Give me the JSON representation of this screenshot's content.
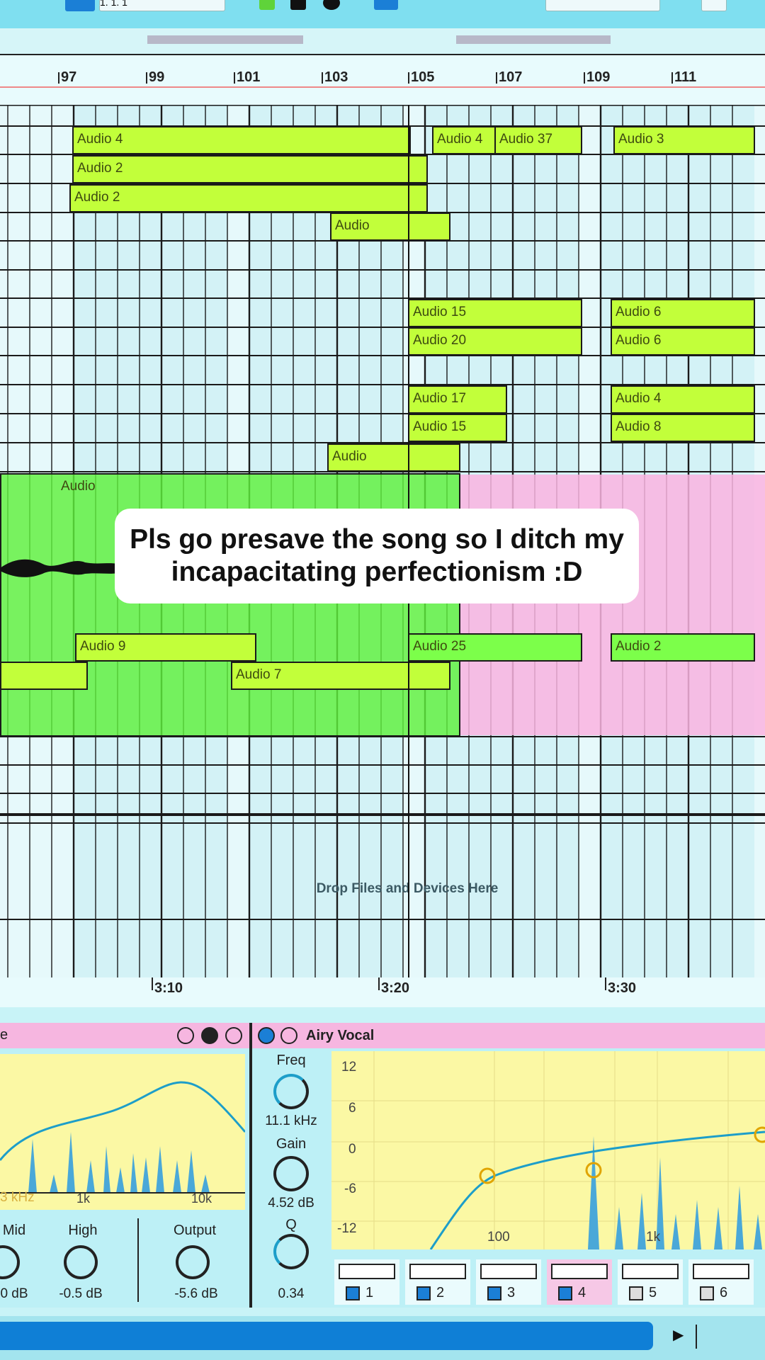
{
  "caption": {
    "text": "Pls go presave the song so I ditch my incapacitating perfectionism :D"
  },
  "transport": {
    "position": "1. 1. 1"
  },
  "ruler": {
    "bars": [
      "97",
      "99",
      "101",
      "103",
      "105",
      "107",
      "109",
      "111"
    ]
  },
  "clips": [
    {
      "name": "Audio 4",
      "row": 0
    },
    {
      "name": "Audio 4",
      "row": 0
    },
    {
      "name": "Audio 37",
      "row": 0
    },
    {
      "name": "Audio 3",
      "row": 0
    },
    {
      "name": "Audio 2",
      "row": 1
    },
    {
      "name": "Audio 2",
      "row": 2
    },
    {
      "name": "Audio",
      "row": 3
    },
    {
      "name": "Audio 15",
      "row": 6
    },
    {
      "name": "Audio 6",
      "row": 6
    },
    {
      "name": "Audio 20",
      "row": 7
    },
    {
      "name": "Audio 6",
      "row": 7
    },
    {
      "name": "Audio 17",
      "row": 9
    },
    {
      "name": "Audio 4",
      "row": 9
    },
    {
      "name": "Audio 15",
      "row": 10
    },
    {
      "name": "Audio 8",
      "row": 10
    },
    {
      "name": "Audio",
      "row": 11
    },
    {
      "name": "Audio",
      "row": 12
    },
    {
      "name": "Audio 9",
      "row": 17
    },
    {
      "name": "Audio 25",
      "row": 17
    },
    {
      "name": "Audio 2",
      "row": 17
    },
    {
      "name": "Audio 7",
      "row": 18
    }
  ],
  "drop_zone": {
    "label": "Drop Files and Devices Here"
  },
  "timeline": {
    "times": [
      "3:10",
      "3:20",
      "3:30"
    ]
  },
  "device1": {
    "title_fragment": "e",
    "freq_labels": [
      "1k",
      "10k"
    ],
    "freq_readout": "3 kHz",
    "knobs": [
      {
        "label": "Mid",
        "value": "0 dB"
      },
      {
        "label": "High",
        "value": "-0.5 dB"
      },
      {
        "label": "Output",
        "value": "-5.6 dB"
      }
    ]
  },
  "device2": {
    "title": "Airy Vocal",
    "knobs": [
      {
        "label": "Freq",
        "value": "11.1 kHz"
      },
      {
        "label": "Gain",
        "value": "4.52 dB"
      },
      {
        "label": "Q",
        "value": "0.34"
      }
    ],
    "db_scale": [
      "12",
      "6",
      "0",
      "-6",
      "-12"
    ],
    "freq_labels": [
      "100",
      "1k"
    ],
    "bands": [
      {
        "num": "1",
        "on": true
      },
      {
        "num": "2",
        "on": true
      },
      {
        "num": "3",
        "on": true
      },
      {
        "num": "4",
        "on": true
      },
      {
        "num": "5",
        "on": false
      },
      {
        "num": "6",
        "on": false
      }
    ]
  },
  "colors": {
    "clip": "#c2ff3a",
    "accent": "#0f7fd6",
    "device_header": "#f6b6e0",
    "eq_bg": "#fbf8a4",
    "curve": "#1d9ec9"
  }
}
